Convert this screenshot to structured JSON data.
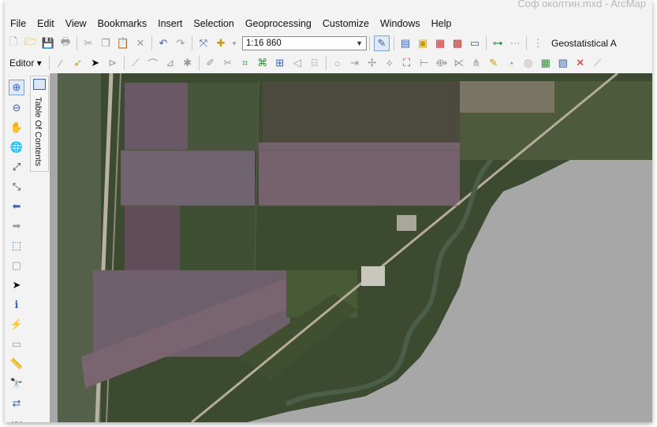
{
  "window": {
    "title": "Соф околтин.mxd - ArcMap"
  },
  "menu": [
    "File",
    "Edit",
    "View",
    "Bookmarks",
    "Insert",
    "Selection",
    "Geoprocessing",
    "Customize",
    "Windows",
    "Help"
  ],
  "toolbar": {
    "scale_value": "1:16 860",
    "geostatistical_label": "Geostatistical A",
    "editor_label": "Editor"
  },
  "toc": {
    "label": "Table Of Contents"
  },
  "icons": {
    "new": "new-document-icon",
    "open": "open-folder-icon",
    "save": "save-icon",
    "print": "print-icon",
    "cut": "cut-icon",
    "copy": "copy-icon",
    "paste": "paste-icon",
    "delete": "delete-icon",
    "undo": "undo-icon",
    "redo": "redo-icon",
    "full_extent": "full-extent-icon",
    "add_data": "add-data-icon"
  },
  "colors": {
    "map_background": "#a7a7a7",
    "accent": "#3a62a8"
  }
}
